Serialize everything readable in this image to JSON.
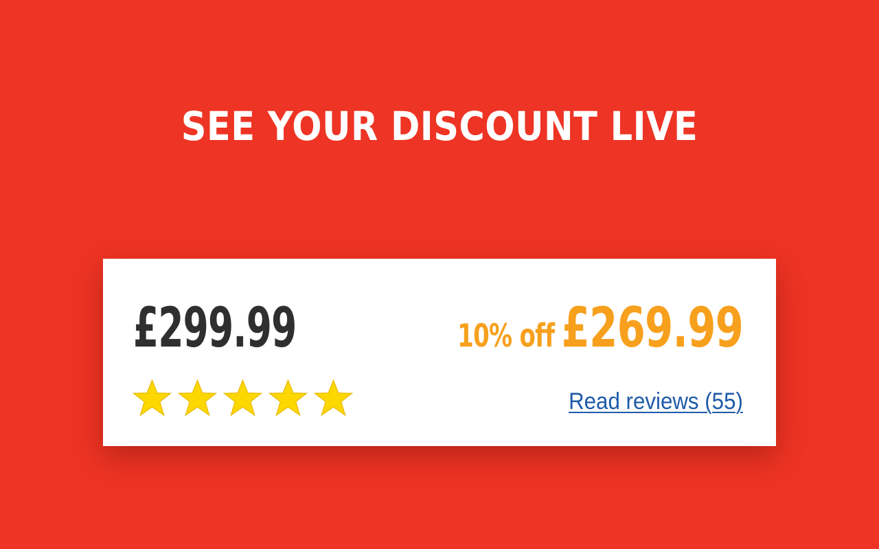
{
  "banner": {
    "headline": "SEE YOUR DISCOUNT LIVE",
    "background_color": "#ee3424"
  },
  "product_card": {
    "original_price": "£299.99",
    "discount_label": "10% off",
    "sale_price": "£269.99",
    "discount_color": "#f7a01d",
    "rating": {
      "stars_total": 5,
      "stars_filled": 5,
      "star_color": "#fcd700",
      "icon": "star-icon"
    },
    "reviews_link": "Read reviews (55)",
    "link_color": "#1e5aa8"
  }
}
